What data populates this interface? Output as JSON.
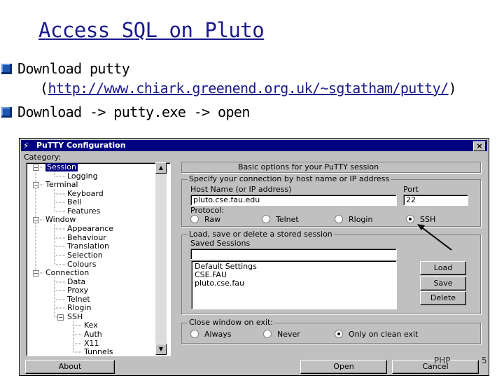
{
  "slide": {
    "title": "Access SQL on Pluto",
    "bullets": [
      {
        "text": "Download putty",
        "continuation_open": "(",
        "url": "http://www.chiark.greenend.org.uk/~sgtatham/putty/",
        "continuation_close": ")"
      },
      {
        "text": "Download -> putty.exe -> open"
      }
    ],
    "footer_left": "PHP",
    "page_number": "5"
  },
  "putty": {
    "window_title": "PuTTY Configuration",
    "close_glyph": "×",
    "category_label": "Category:",
    "tree": [
      "Session",
      "Logging",
      "Terminal",
      "Keyboard",
      "Bell",
      "Features",
      "Window",
      "Appearance",
      "Behaviour",
      "Translation",
      "Selection",
      "Colours",
      "Connection",
      "Data",
      "Proxy",
      "Telnet",
      "Rlogin",
      "SSH",
      "Kex",
      "Auth",
      "X11",
      "Tunnels"
    ],
    "basic_options_header": "Basic options for your PuTTY session",
    "specify_group": "Specify your connection by host name or IP address",
    "host_label": "Host Name (or IP address)",
    "host_value": "pluto.cse.fau.edu",
    "port_label": "Port",
    "port_value": "22",
    "protocol_label": "Protocol:",
    "protocols": [
      "Raw",
      "Telnet",
      "Rlogin",
      "SSH"
    ],
    "protocol_selected": "SSH",
    "sessions_group": "Load, save or delete a stored session",
    "saved_sessions_label": "Saved Sessions",
    "saved_sessions_value": "",
    "sessions": [
      "Default Settings",
      "CSE.FAU",
      "pluto.cse.fau"
    ],
    "load_button": "Load",
    "save_button": "Save",
    "delete_button": "Delete",
    "close_on_exit_group": "Close window on exit:",
    "close_options": [
      "Always",
      "Never",
      "Only on clean exit"
    ],
    "close_selected": "Only on clean exit",
    "about_button": "About",
    "open_button": "Open",
    "cancel_button": "Cancel"
  }
}
